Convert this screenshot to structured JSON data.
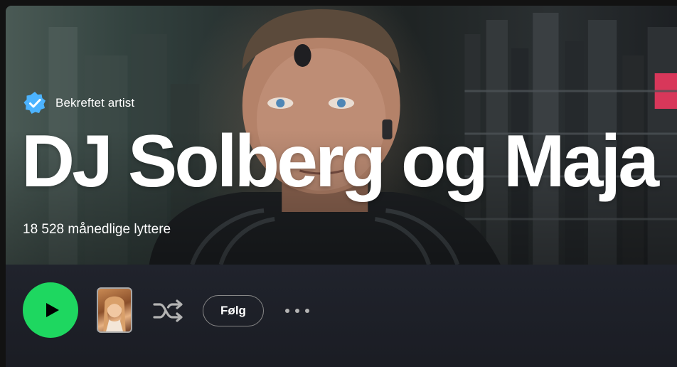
{
  "artist": {
    "verified_label": "Bekreftet artist",
    "name": "DJ Solberg og Maja",
    "monthly_listeners": "18 528 månedlige lyttere"
  },
  "actions": {
    "follow_label": "Følg"
  },
  "icons": {
    "verified": "verified-badge-icon",
    "play": "play-icon",
    "shuffle": "shuffle-icon",
    "more": "more-options-icon"
  },
  "colors": {
    "accent_green": "#1ed760",
    "verified_blue": "#4cb3ff",
    "background": "#121212",
    "action_bar": "#1b1d25",
    "text": "#ffffff"
  }
}
